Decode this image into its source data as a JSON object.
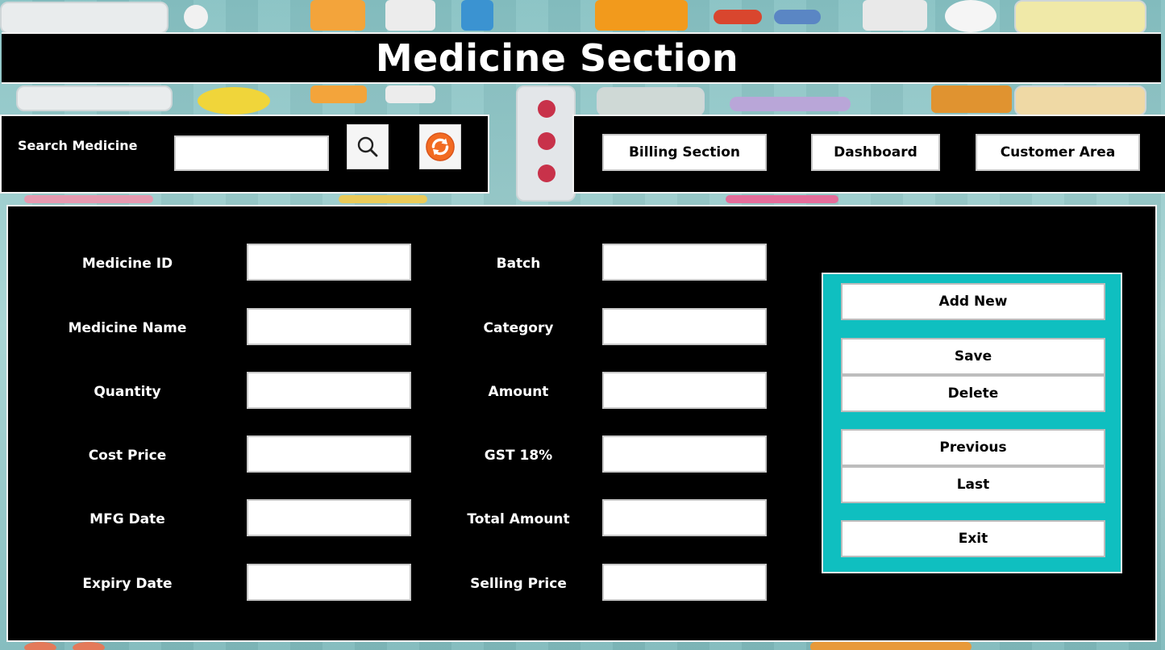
{
  "header": {
    "title": "Medicine Section"
  },
  "search": {
    "label": "Search Medicine",
    "value": "",
    "placeholder": "",
    "search_icon": "magnifier-icon",
    "refresh_icon": "refresh-icon"
  },
  "nav": {
    "billing_label": "Billing Section",
    "dashboard_label": "Dashboard",
    "customer_label": "Customer Area"
  },
  "form": {
    "left": [
      {
        "label": "Medicine ID",
        "value": ""
      },
      {
        "label": "Medicine Name",
        "value": ""
      },
      {
        "label": "Quantity",
        "value": ""
      },
      {
        "label": "Cost Price",
        "value": ""
      },
      {
        "label": "MFG Date",
        "value": ""
      },
      {
        "label": "Expiry Date",
        "value": ""
      }
    ],
    "right": [
      {
        "label": "Batch",
        "value": ""
      },
      {
        "label": "Category",
        "value": ""
      },
      {
        "label": "Amount",
        "value": ""
      },
      {
        "label": "GST 18%",
        "value": ""
      },
      {
        "label": "Total Amount",
        "value": ""
      },
      {
        "label": "Selling Price",
        "value": ""
      }
    ]
  },
  "actions": {
    "add_new": "Add New",
    "save": "Save",
    "delete": "Delete",
    "previous": "Previous",
    "last": "Last",
    "exit": "Exit"
  },
  "colors": {
    "panel_bg": "#000000",
    "action_panel_bg": "#0fbfc0",
    "refresh_orange": "#f26b22",
    "background_teal": "#8ec7c9"
  }
}
